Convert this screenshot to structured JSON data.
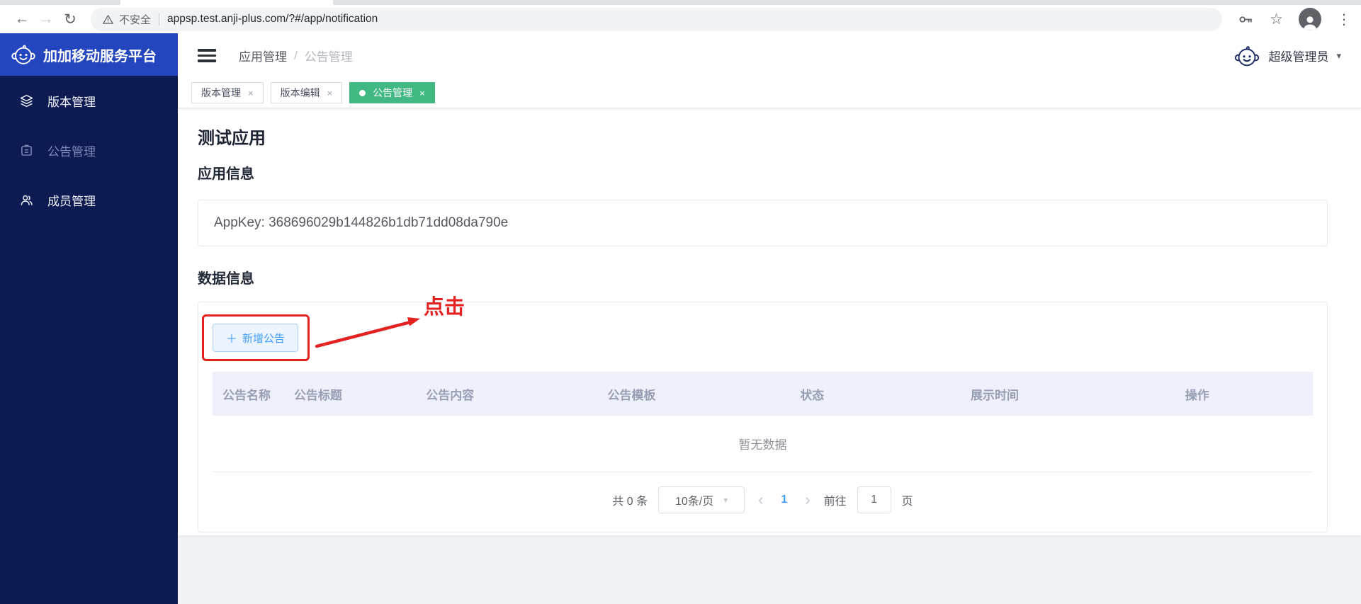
{
  "browser": {
    "security_label": "不安全",
    "url": "appsp.test.anji-plus.com/?#/app/notification",
    "icons": {
      "back": "←",
      "forward": "→",
      "reload": "↻",
      "star": "☆",
      "more": "⋮"
    }
  },
  "sidebar": {
    "brand": "加加移动服务平台",
    "items": [
      {
        "label": "版本管理",
        "icon": "layers-icon"
      },
      {
        "label": "公告管理",
        "icon": "clipboard-icon"
      },
      {
        "label": "成员管理",
        "icon": "users-icon"
      }
    ]
  },
  "header": {
    "breadcrumb": [
      "应用管理",
      "公告管理"
    ],
    "breadcrumb_separator": "/",
    "user_name": "超级管理员",
    "caret": "▾"
  },
  "tabs": {
    "close_glyph": "×",
    "items": [
      {
        "label": "版本管理"
      },
      {
        "label": "版本编辑"
      },
      {
        "label": "公告管理"
      }
    ]
  },
  "main": {
    "app_title": "测试应用",
    "app_info_heading": "应用信息",
    "appkey_text": "AppKey: 368696029b144826b1db71dd08da790e",
    "data_heading": "数据信息",
    "add_button": {
      "icon": "＋",
      "label": "新增公告"
    },
    "annotation_label": "点击",
    "table": {
      "columns": [
        "公告名称",
        "公告标题",
        "公告内容",
        "公告模板",
        "状态",
        "展示时间",
        "操作"
      ],
      "empty_text": "暂无数据"
    },
    "pagination": {
      "total_text": "共 0 条",
      "page_size_text": "10条/页",
      "select_caret": "▾",
      "prev_glyph": "‹",
      "next_glyph": "›",
      "current_page": "1",
      "goto_label": "前往",
      "goto_value": "1",
      "unit_label": "页"
    }
  },
  "colors": {
    "brand_blue": "#2345bd",
    "sidebar_navy": "#0e1b52",
    "active_tab_green": "#42b983",
    "accent_blue": "#409eff",
    "annotation_red": "#e52222",
    "table_header_bg": "#eef1fc"
  }
}
